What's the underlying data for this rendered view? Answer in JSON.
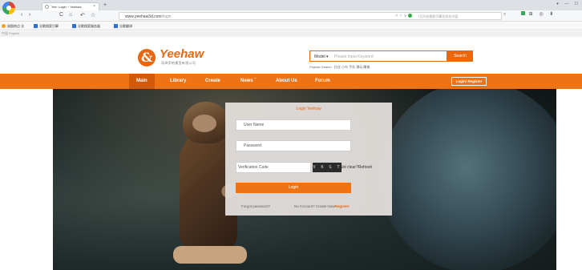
{
  "browser": {
    "tab_title": "Yee: Login ~ Yeehaw",
    "tab_close": "×",
    "new_tab": "+",
    "window_controls": "▾ — ☐",
    "nav": {
      "back": "‹",
      "forward": "›",
      "refresh": "C",
      "home": "⌂",
      "undo": "↶",
      "star": "☆"
    },
    "url_host": "www.yeehaw3d.com",
    "url_path": "/login",
    "url_extras": "⚡ ☆ ∨",
    "search_suggest": "7日开启搜索引擎及优先内容",
    "search_icon": "⌕",
    "toolbar": "⊞ ◎ ⬇",
    "bookmarks": [
      {
        "label": "阅图热点 谷",
        "color": "#f0a020"
      },
      {
        "label": "谷歌搜索引擎",
        "color": "#2f6fd0"
      },
      {
        "label": "谷歌搜索服务器",
        "color": "#2f6fd0"
      },
      {
        "label": "谷歌翻译",
        "color": "#2f6fd0"
      }
    ],
    "language_bar": "中国 English"
  },
  "header": {
    "logo_mark": "&",
    "logo_text": "Yeehaw",
    "logo_subtitle": "深圳伊哈模型有限公司",
    "search_model": "Model ▾",
    "search_placeholder": "Please Input Keyword",
    "search_button": "Search",
    "popular_search": "Popular Search : 拉丝  小鸟  手办  潮玩  雕像"
  },
  "nav": {
    "items": [
      "Main",
      "Library",
      "Create",
      "News",
      "About Us",
      "Forum"
    ],
    "news_caret": "ˇ",
    "login_register": "Login/ Register"
  },
  "login": {
    "title": "Login Yeehaw",
    "username_placeholder": "User Name",
    "password_placeholder": "Password",
    "code_placeholder": "Verification Code",
    "captcha_text": "V K G T",
    "refresh_text": "Not clear?Refresh",
    "login_button": "Login",
    "forgot_password": "Forgot password?",
    "no_account": "No Account? Create Now",
    "register_link": "Register"
  },
  "colors": {
    "brand_orange": "#ee7314",
    "nav_active": "#d1590a"
  }
}
